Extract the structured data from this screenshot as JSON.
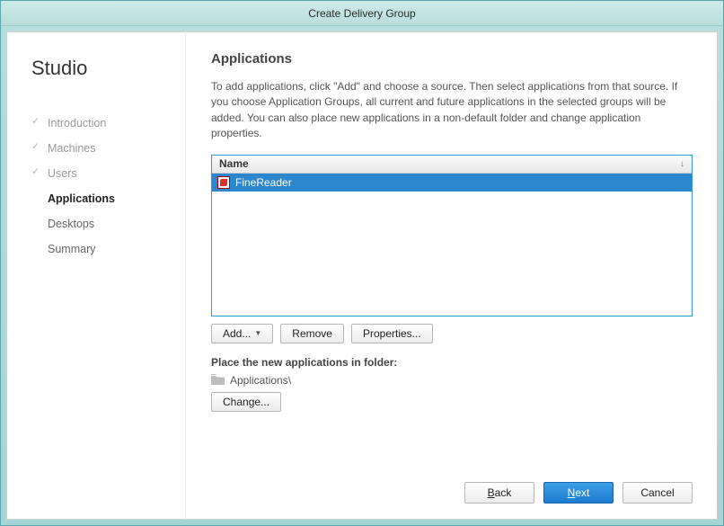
{
  "window": {
    "title": "Create Delivery Group"
  },
  "sidebar": {
    "title": "Studio",
    "items": [
      {
        "label": "Introduction",
        "state": "done"
      },
      {
        "label": "Machines",
        "state": "done"
      },
      {
        "label": "Users",
        "state": "done"
      },
      {
        "label": "Applications",
        "state": "active"
      },
      {
        "label": "Desktops",
        "state": "pending"
      },
      {
        "label": "Summary",
        "state": "pending"
      }
    ]
  },
  "main": {
    "heading": "Applications",
    "description": "To add applications, click \"Add\" and choose a source. Then select applications from that source. If you choose Application Groups, all current and future applications in the selected groups will be added. You can also place new applications in a non-default folder and change application properties.",
    "table": {
      "column": "Name",
      "rows": [
        {
          "name": "FineReader"
        }
      ]
    },
    "buttons": {
      "add": "Add...",
      "remove": "Remove",
      "properties": "Properties..."
    },
    "folder": {
      "label": "Place the new applications in folder:",
      "path": "Applications\\",
      "change": "Change..."
    }
  },
  "footer": {
    "back": "ack",
    "back_mnemonic": "B",
    "next": "ext",
    "next_mnemonic": "N",
    "cancel": "Cancel"
  }
}
